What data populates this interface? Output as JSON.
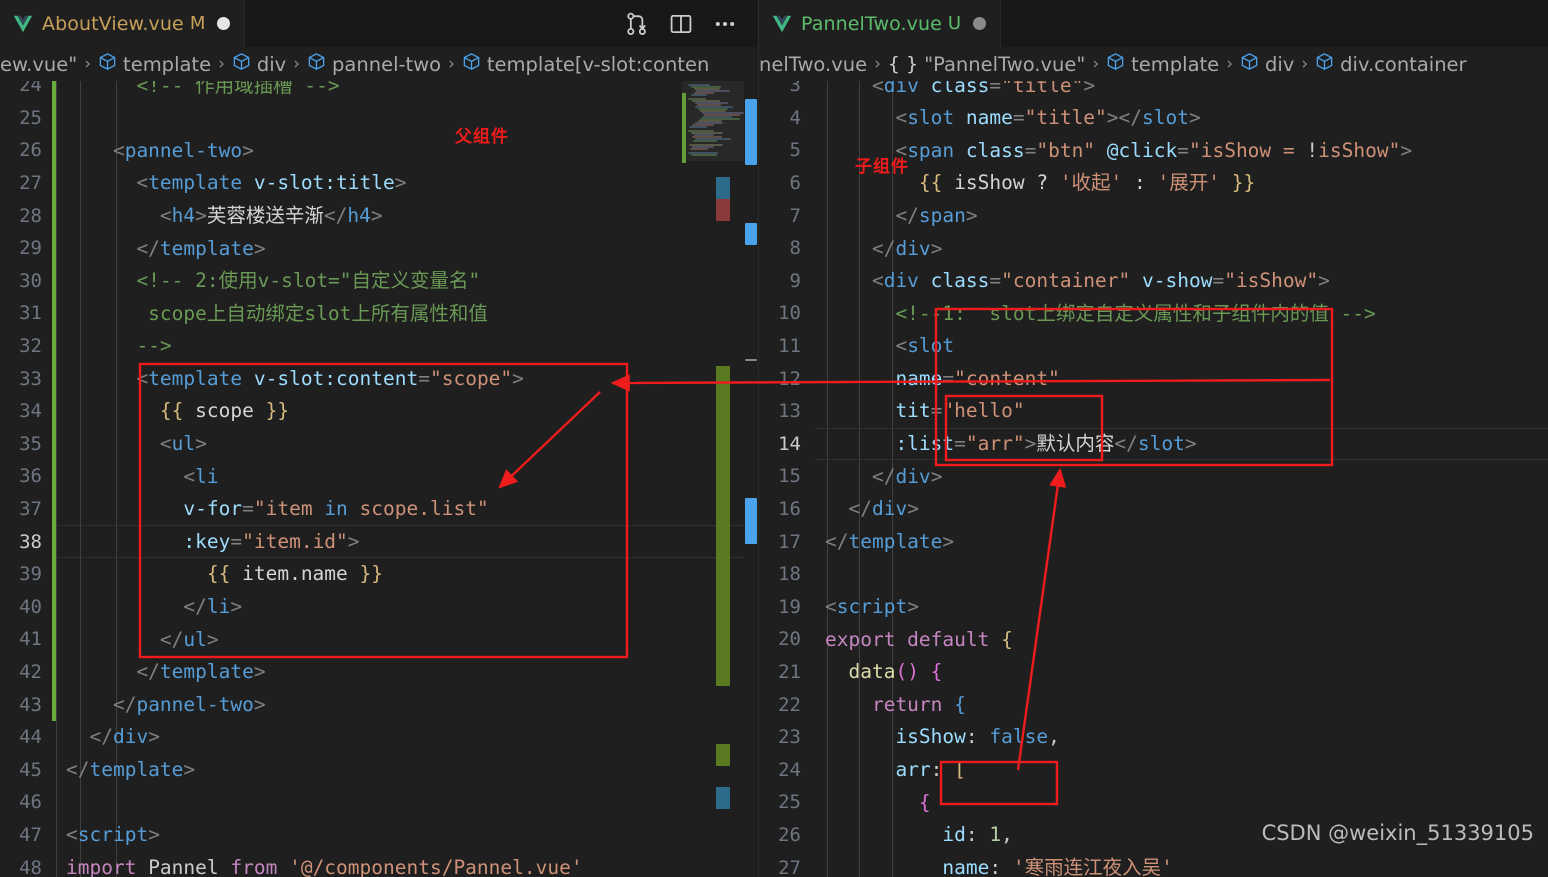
{
  "window": {
    "theme_bg": "#1f1f1f",
    "accent_red": "#ee1c1c"
  },
  "left_editor": {
    "tab": {
      "label": "AboutView.vue",
      "badge": "M",
      "dirty": true,
      "icon": "vue-icon"
    },
    "actions": [
      {
        "name": "source-control-icon",
        "title": "Source Control"
      },
      {
        "name": "split-editor-icon",
        "title": "Split Editor Right"
      },
      {
        "name": "more-actions-icon",
        "title": "More Actions..."
      }
    ],
    "breadcrumb": [
      {
        "text": "ew.vue\"",
        "icon": "none"
      },
      {
        "text": "template",
        "icon": "cube-icon"
      },
      {
        "text": "div",
        "icon": "cube-icon"
      },
      {
        "text": "pannel-two",
        "icon": "cube-icon"
      },
      {
        "text": "template[v-slot:conten",
        "icon": "cube-icon"
      }
    ],
    "active_line": 38,
    "lines": [
      {
        "n": 24,
        "git": "mod",
        "clipped": true,
        "tokens": [
          {
            "t": "cmt",
            "v": "      <!-- 作用域插槽 -->"
          }
        ]
      },
      {
        "n": 25,
        "git": "mod",
        "tokens": []
      },
      {
        "n": 26,
        "git": "mod",
        "tokens": [
          {
            "t": "brk",
            "v": "    <"
          },
          {
            "t": "tag",
            "v": "pannel-two"
          },
          {
            "t": "brk",
            "v": ">"
          }
        ]
      },
      {
        "n": 27,
        "git": "mod",
        "tokens": [
          {
            "t": "brk",
            "v": "      <"
          },
          {
            "t": "tag",
            "v": "template "
          },
          {
            "t": "attr",
            "v": "v-slot:title"
          },
          {
            "t": "brk",
            "v": ">"
          }
        ]
      },
      {
        "n": 28,
        "git": "mod",
        "tokens": [
          {
            "t": "brk",
            "v": "        <"
          },
          {
            "t": "tag",
            "v": "h4"
          },
          {
            "t": "brk",
            "v": ">"
          },
          {
            "t": "txt",
            "v": "芙蓉楼送辛渐"
          },
          {
            "t": "brk",
            "v": "</"
          },
          {
            "t": "tag",
            "v": "h4"
          },
          {
            "t": "brk",
            "v": ">"
          }
        ]
      },
      {
        "n": 29,
        "git": "mod",
        "tokens": [
          {
            "t": "brk",
            "v": "      </"
          },
          {
            "t": "tag",
            "v": "template"
          },
          {
            "t": "brk",
            "v": ">"
          }
        ]
      },
      {
        "n": 30,
        "git": "mod",
        "tokens": [
          {
            "t": "cmt",
            "v": "      <!-- 2:使用v-slot=\"自定义变量名\""
          }
        ]
      },
      {
        "n": 31,
        "git": "mod",
        "tokens": [
          {
            "t": "cmt",
            "v": "       scope上自动绑定slot上所有属性和值"
          }
        ]
      },
      {
        "n": 32,
        "git": "mod",
        "tokens": [
          {
            "t": "cmt",
            "v": "      -->"
          }
        ]
      },
      {
        "n": 33,
        "git": "mod",
        "tokens": [
          {
            "t": "brk",
            "v": "      <"
          },
          {
            "t": "tag",
            "v": "template "
          },
          {
            "t": "attr",
            "v": "v-slot:content"
          },
          {
            "t": "brk",
            "v": "="
          },
          {
            "t": "str",
            "v": "\"scope\""
          },
          {
            "t": "brk",
            "v": ">"
          }
        ]
      },
      {
        "n": 34,
        "git": "mod",
        "tokens": [
          {
            "t": "yel",
            "v": "        {{"
          },
          {
            "t": "txt",
            "v": " scope "
          },
          {
            "t": "yel",
            "v": "}}"
          }
        ]
      },
      {
        "n": 35,
        "git": "mod",
        "tokens": [
          {
            "t": "brk",
            "v": "        <"
          },
          {
            "t": "tag",
            "v": "ul"
          },
          {
            "t": "brk",
            "v": ">"
          }
        ]
      },
      {
        "n": 36,
        "git": "mod",
        "tokens": [
          {
            "t": "brk",
            "v": "          <"
          },
          {
            "t": "tag",
            "v": "li"
          }
        ]
      },
      {
        "n": 37,
        "git": "mod",
        "tokens": [
          {
            "t": "attr",
            "v": "          v-for"
          },
          {
            "t": "brk",
            "v": "="
          },
          {
            "t": "str",
            "v": "\"item "
          },
          {
            "t": "blue",
            "v": "in"
          },
          {
            "t": "str",
            "v": " scope.list\""
          }
        ]
      },
      {
        "n": 38,
        "git": "mod",
        "tokens": [
          {
            "t": "attr",
            "v": "          :key"
          },
          {
            "t": "brk",
            "v": "="
          },
          {
            "t": "str",
            "v": "\"item.id\""
          },
          {
            "t": "brk",
            "v": ">"
          }
        ]
      },
      {
        "n": 39,
        "git": "mod",
        "tokens": [
          {
            "t": "yel",
            "v": "            {{"
          },
          {
            "t": "txt",
            "v": " item.name "
          },
          {
            "t": "yel",
            "v": "}}"
          }
        ]
      },
      {
        "n": 40,
        "git": "mod",
        "tokens": [
          {
            "t": "brk",
            "v": "          </"
          },
          {
            "t": "tag",
            "v": "li"
          },
          {
            "t": "brk",
            "v": ">"
          }
        ]
      },
      {
        "n": 41,
        "git": "mod",
        "tokens": [
          {
            "t": "brk",
            "v": "        </"
          },
          {
            "t": "tag",
            "v": "ul"
          },
          {
            "t": "brk",
            "v": ">"
          }
        ]
      },
      {
        "n": 42,
        "git": "mod",
        "tokens": [
          {
            "t": "brk",
            "v": "      </"
          },
          {
            "t": "tag",
            "v": "template"
          },
          {
            "t": "brk",
            "v": ">"
          }
        ]
      },
      {
        "n": 43,
        "git": "mod",
        "tokens": [
          {
            "t": "brk",
            "v": "    </"
          },
          {
            "t": "tag",
            "v": "pannel-two"
          },
          {
            "t": "brk",
            "v": ">"
          }
        ]
      },
      {
        "n": 44,
        "git": "none",
        "tokens": [
          {
            "t": "brk",
            "v": "  </"
          },
          {
            "t": "tag",
            "v": "div"
          },
          {
            "t": "brk",
            "v": ">"
          }
        ]
      },
      {
        "n": 45,
        "git": "none",
        "tokens": [
          {
            "t": "brk",
            "v": "</"
          },
          {
            "t": "tag",
            "v": "template"
          },
          {
            "t": "brk",
            "v": ">"
          }
        ]
      },
      {
        "n": 46,
        "git": "none",
        "tokens": []
      },
      {
        "n": 47,
        "git": "none",
        "tokens": [
          {
            "t": "brk",
            "v": "<"
          },
          {
            "t": "tag",
            "v": "script"
          },
          {
            "t": "brk",
            "v": ">"
          }
        ]
      },
      {
        "n": 48,
        "git": "none",
        "clipped": true,
        "tokens": [
          {
            "t": "pink",
            "v": "import"
          },
          {
            "t": "white",
            "v": " Pannel "
          },
          {
            "t": "pink",
            "v": "from"
          },
          {
            "t": "str",
            "v": " '@/components/Pannel.vue'"
          }
        ]
      }
    ],
    "annotations": [
      {
        "name": "parent-component-label",
        "text": "父组件"
      }
    ]
  },
  "right_editor": {
    "tab": {
      "label": "PannelTwo.vue",
      "badge": "U",
      "dirty": true,
      "icon": "vue-icon"
    },
    "breadcrumb": [
      {
        "text": "nelTwo.vue",
        "icon": "none"
      },
      {
        "text": "\"PannelTwo.vue\"",
        "icon": "braces-icon"
      },
      {
        "text": "template",
        "icon": "cube-icon"
      },
      {
        "text": "div",
        "icon": "cube-icon"
      },
      {
        "text": "div.container",
        "icon": "cube-icon"
      }
    ],
    "active_line": 14,
    "lines": [
      {
        "n": 3,
        "clipped": true,
        "tokens": [
          {
            "t": "brk",
            "v": "    <"
          },
          {
            "t": "tag",
            "v": "div "
          },
          {
            "t": "attr",
            "v": "class"
          },
          {
            "t": "brk",
            "v": "="
          },
          {
            "t": "str",
            "v": "\"title\""
          },
          {
            "t": "brk",
            "v": ">"
          }
        ]
      },
      {
        "n": 4,
        "tokens": [
          {
            "t": "brk",
            "v": "      <"
          },
          {
            "t": "tag",
            "v": "slot "
          },
          {
            "t": "attr",
            "v": "name"
          },
          {
            "t": "brk",
            "v": "="
          },
          {
            "t": "str",
            "v": "\"title\""
          },
          {
            "t": "brk",
            "v": "></"
          },
          {
            "t": "tag",
            "v": "slot"
          },
          {
            "t": "brk",
            "v": ">"
          }
        ]
      },
      {
        "n": 5,
        "tokens": [
          {
            "t": "brk",
            "v": "      <"
          },
          {
            "t": "tag",
            "v": "span "
          },
          {
            "t": "attr",
            "v": "class"
          },
          {
            "t": "brk",
            "v": "="
          },
          {
            "t": "str",
            "v": "\"btn\""
          },
          {
            "t": "attr",
            "v": " @click"
          },
          {
            "t": "brk",
            "v": "="
          },
          {
            "t": "str",
            "v": "\"isShow = "
          },
          {
            "t": "white",
            "v": "!"
          },
          {
            "t": "str",
            "v": "isShow\""
          },
          {
            "t": "brk",
            "v": ">"
          }
        ]
      },
      {
        "n": 6,
        "tokens": [
          {
            "t": "yel",
            "v": "        {{"
          },
          {
            "t": "txt",
            "v": " isShow ? "
          },
          {
            "t": "str",
            "v": "'收起'"
          },
          {
            "t": "txt",
            "v": " : "
          },
          {
            "t": "str",
            "v": "'展开'"
          },
          {
            "t": "txt",
            "v": " "
          },
          {
            "t": "yel",
            "v": "}}"
          }
        ]
      },
      {
        "n": 7,
        "tokens": [
          {
            "t": "brk",
            "v": "      </"
          },
          {
            "t": "tag",
            "v": "span"
          },
          {
            "t": "brk",
            "v": ">"
          }
        ]
      },
      {
        "n": 8,
        "tokens": [
          {
            "t": "brk",
            "v": "    </"
          },
          {
            "t": "tag",
            "v": "div"
          },
          {
            "t": "brk",
            "v": ">"
          }
        ]
      },
      {
        "n": 9,
        "tokens": [
          {
            "t": "brk",
            "v": "    <"
          },
          {
            "t": "tag",
            "v": "div "
          },
          {
            "t": "attr",
            "v": "class"
          },
          {
            "t": "brk",
            "v": "="
          },
          {
            "t": "str",
            "v": "\"container\""
          },
          {
            "t": "attr",
            "v": " v-show"
          },
          {
            "t": "brk",
            "v": "="
          },
          {
            "t": "str",
            "v": "\"isShow\""
          },
          {
            "t": "brk",
            "v": ">"
          }
        ]
      },
      {
        "n": 10,
        "tokens": [
          {
            "t": "cmt",
            "v": "      <!--1:  slot上绑定自定义属性和子组件内的值 -->"
          }
        ]
      },
      {
        "n": 11,
        "tokens": [
          {
            "t": "brk",
            "v": "      <"
          },
          {
            "t": "tag",
            "v": "slot"
          }
        ]
      },
      {
        "n": 12,
        "tokens": [
          {
            "t": "attr",
            "v": "      name"
          },
          {
            "t": "brk",
            "v": "="
          },
          {
            "t": "str",
            "v": "\"content\""
          }
        ]
      },
      {
        "n": 13,
        "tokens": [
          {
            "t": "attr",
            "v": "      tit"
          },
          {
            "t": "brk",
            "v": "="
          },
          {
            "t": "str",
            "v": "\"hello\""
          }
        ]
      },
      {
        "n": 14,
        "tokens": [
          {
            "t": "attr",
            "v": "      :list"
          },
          {
            "t": "brk",
            "v": "="
          },
          {
            "t": "str",
            "v": "\"arr\""
          },
          {
            "t": "brk",
            "v": ">"
          },
          {
            "t": "txt",
            "v": "默认内容"
          },
          {
            "t": "brk",
            "v": "</"
          },
          {
            "t": "tag",
            "v": "slot"
          },
          {
            "t": "brk",
            "v": ">"
          }
        ]
      },
      {
        "n": 15,
        "tokens": [
          {
            "t": "brk",
            "v": "    </"
          },
          {
            "t": "tag",
            "v": "div"
          },
          {
            "t": "brk",
            "v": ">"
          }
        ]
      },
      {
        "n": 16,
        "tokens": [
          {
            "t": "brk",
            "v": "  </"
          },
          {
            "t": "tag",
            "v": "div"
          },
          {
            "t": "brk",
            "v": ">"
          }
        ]
      },
      {
        "n": 17,
        "tokens": [
          {
            "t": "brk",
            "v": "</"
          },
          {
            "t": "tag",
            "v": "template"
          },
          {
            "t": "brk",
            "v": ">"
          }
        ]
      },
      {
        "n": 18,
        "tokens": []
      },
      {
        "n": 19,
        "tokens": [
          {
            "t": "brk",
            "v": "<"
          },
          {
            "t": "tag",
            "v": "script"
          },
          {
            "t": "brk",
            "v": ">"
          }
        ]
      },
      {
        "n": 20,
        "tokens": [
          {
            "t": "pink",
            "v": "export default"
          },
          {
            "t": "yel",
            "v": " {"
          }
        ]
      },
      {
        "n": 21,
        "tokens": [
          {
            "t": "fn",
            "v": "  data"
          },
          {
            "t": "pur",
            "v": "()"
          },
          {
            "t": "pur",
            "v": " {"
          }
        ]
      },
      {
        "n": 22,
        "tokens": [
          {
            "t": "pink",
            "v": "    return"
          },
          {
            "t": "blue",
            "v": " {"
          }
        ]
      },
      {
        "n": 23,
        "tokens": [
          {
            "t": "attr",
            "v": "      isShow"
          },
          {
            "t": "white",
            "v": ": "
          },
          {
            "t": "blue",
            "v": "false"
          },
          {
            "t": "white",
            "v": ","
          }
        ]
      },
      {
        "n": 24,
        "tokens": [
          {
            "t": "attr",
            "v": "      arr"
          },
          {
            "t": "white",
            "v": ": "
          },
          {
            "t": "yel",
            "v": "["
          }
        ]
      },
      {
        "n": 25,
        "tokens": [
          {
            "t": "pur",
            "v": "        {"
          }
        ]
      },
      {
        "n": 26,
        "tokens": [
          {
            "t": "attr",
            "v": "          id"
          },
          {
            "t": "white",
            "v": ": "
          },
          {
            "t": "num",
            "v": "1"
          },
          {
            "t": "white",
            "v": ","
          }
        ]
      },
      {
        "n": 27,
        "clipped": true,
        "tokens": [
          {
            "t": "attr",
            "v": "          name"
          },
          {
            "t": "white",
            "v": ": "
          },
          {
            "t": "str",
            "v": "'寒雨连江夜入吴'"
          }
        ]
      }
    ],
    "annotations": [
      {
        "name": "child-component-label",
        "text": "子组件"
      }
    ]
  },
  "watermark": {
    "text": "CSDN @weixin_51339105"
  }
}
